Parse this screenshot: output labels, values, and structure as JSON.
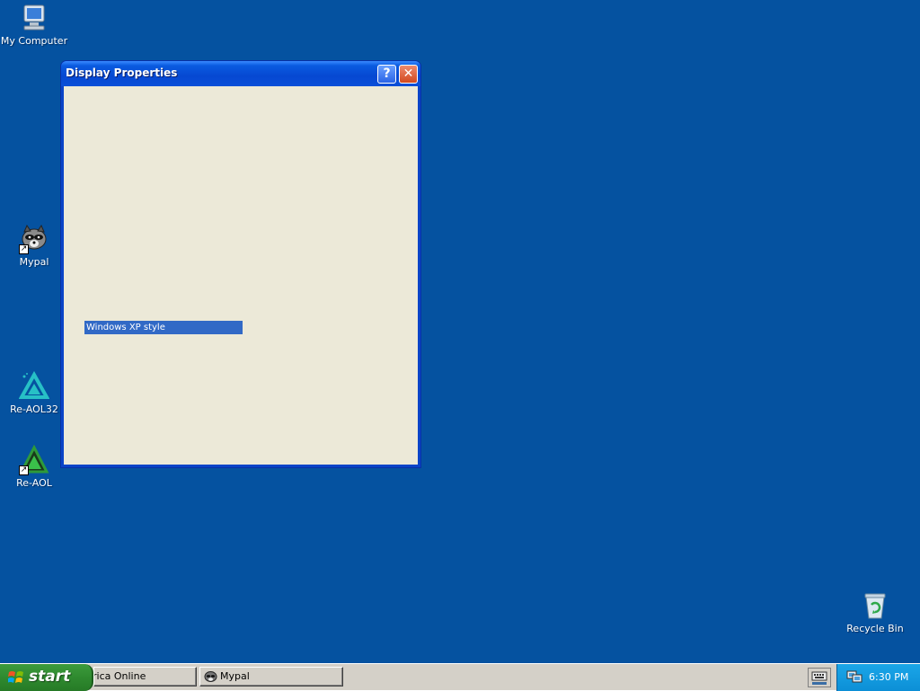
{
  "desktop": {
    "background_color": "#0552a0",
    "icons": [
      {
        "label": "My Computer",
        "icon": "computer-icon",
        "shortcut": false
      },
      {
        "label": "Mypal",
        "icon": "raccoon-icon",
        "shortcut": true
      },
      {
        "label": "Re-AOL32",
        "icon": "aol-triangle-icon",
        "shortcut": false
      },
      {
        "label": "Re-AOL",
        "icon": "aol-triangle-icon",
        "shortcut": true
      },
      {
        "label": "Recycle Bin",
        "icon": "recycle-bin-icon",
        "shortcut": false
      }
    ]
  },
  "window": {
    "title": "Display Properties",
    "help_label": "?",
    "close_label": "✕",
    "selected_field_text": "Windows XP style",
    "selection_color": "#3169c6",
    "body_color": "#ece9d8"
  },
  "taskbar": {
    "start_label": "start",
    "tasks": [
      {
        "label": "rica  Online"
      },
      {
        "label": "Mypal"
      }
    ],
    "clock": "6:30 PM",
    "tray_color": "#1ba6e8"
  }
}
